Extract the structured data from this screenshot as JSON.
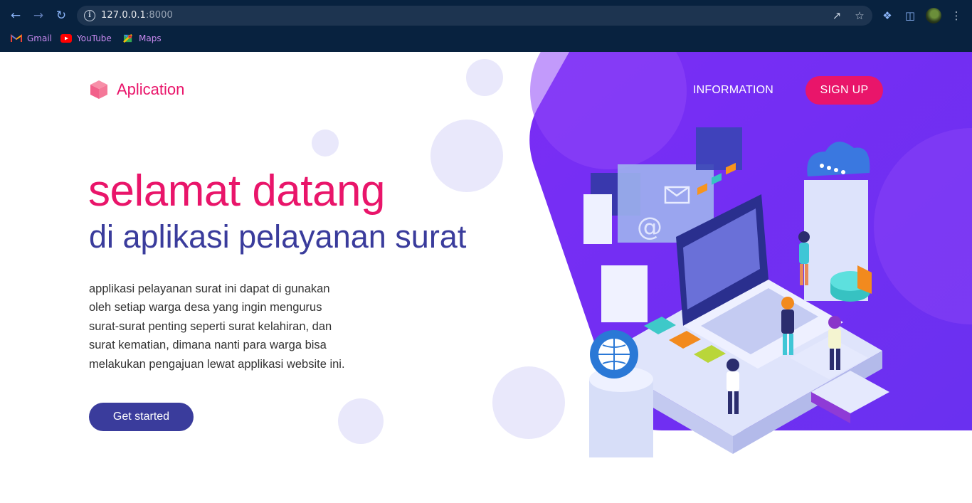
{
  "browser": {
    "url_host": "127.0.0.1",
    "url_port": ":8000",
    "bookmarks": [
      {
        "label": "Gmail",
        "icon": "gmail-icon"
      },
      {
        "label": "YouTube",
        "icon": "youtube-icon"
      },
      {
        "label": "Maps",
        "icon": "maps-icon"
      }
    ]
  },
  "header": {
    "logo_text": "Aplication",
    "nav": {
      "information": "INFORMATION",
      "signup": "SIGN UP"
    }
  },
  "hero": {
    "title": "selamat datang",
    "subtitle": "di aplikasi pelayanan surat",
    "description": "applikasi pelayanan surat ini dapat di gunakan oleh setiap warga desa yang ingin mengurus surat-surat penting seperti surat kelahiran, dan surat kematian, dimana nanti para warga bisa melakukan pengajuan lewat applikasi website ini.",
    "cta_label": "Get started"
  },
  "colors": {
    "brand_pink": "#e9156a",
    "brand_indigo": "#3a3c9c",
    "hero_purple": "#6c2bf2",
    "browser_chrome": "#08223f"
  }
}
